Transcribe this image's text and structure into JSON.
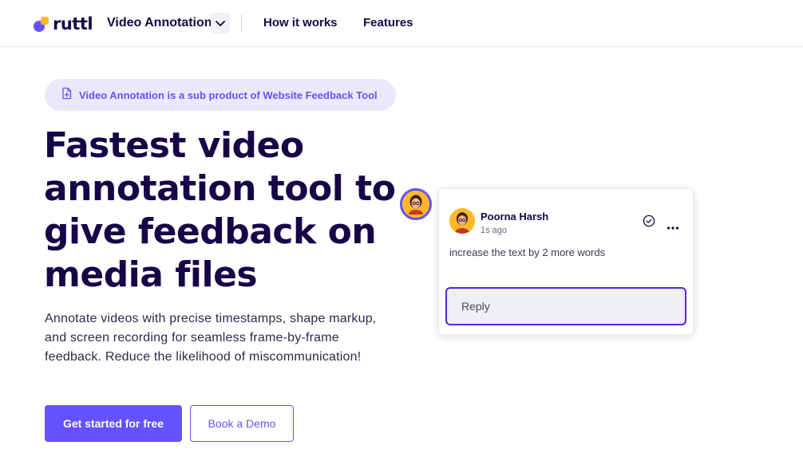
{
  "nav": {
    "logo_text": "ruttl",
    "product": "Video Annotation",
    "links": [
      "How it works",
      "Features"
    ]
  },
  "hero": {
    "pill_text": "Video Annotation is a sub product of Website Feedback Tool",
    "headline": [
      "Fastest video",
      "annotation tool to",
      "give feedback on",
      "media files"
    ],
    "subtext": "Annotate videos with precise timestamps, shape markup, and screen recording for seamless frame-by-frame feedback. Reduce the likelihood of miscommunication!",
    "primary_cta": "Get started for free",
    "secondary_cta": "Book a Demo"
  },
  "comment": {
    "author": "Poorna Harsh",
    "time": "1s ago",
    "text": "increase the text by 2 more words",
    "reply_placeholder": "Reply"
  },
  "colors": {
    "brand": "#6552ff",
    "accent": "#ffb829",
    "ink": "#160647"
  },
  "icons": {
    "pill": "file-plus-icon",
    "resolve": "check-circle-icon",
    "more": "more-horizontal-icon",
    "dropdown": "chevron-down-icon"
  }
}
